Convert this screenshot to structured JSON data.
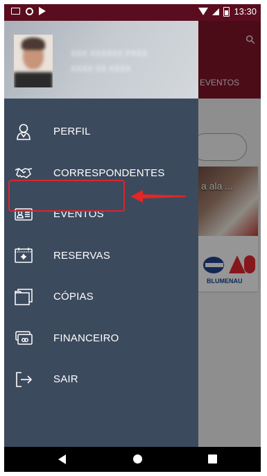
{
  "status_bar": {
    "time": "13:30",
    "icons": [
      "gmail-icon",
      "circle-notification-icon",
      "flag-notification-icon",
      "wifi-icon",
      "signal-icon",
      "battery-icon"
    ]
  },
  "app_background": {
    "tab_label": "EVENTOS",
    "card_text": "a ala ...",
    "logo_text": "BLUMENAU",
    "primary_color": "#7a1428"
  },
  "drawer": {
    "background_color": "#3c4a5e",
    "user_name": "XXX XXXXXX PXXX",
    "user_id": "XXXX XX XXXX",
    "menu_items": [
      {
        "label": "PERFIL",
        "icon": "user-profile-icon"
      },
      {
        "label": "CORRESPONDENTES",
        "icon": "handshake-icon"
      },
      {
        "label": "EVENTOS",
        "icon": "id-card-icon"
      },
      {
        "label": "RESERVAS",
        "icon": "calendar-icon"
      },
      {
        "label": "CÓPIAS",
        "icon": "folder-copies-icon"
      },
      {
        "label": "FINANCEIRO",
        "icon": "wallet-icon"
      },
      {
        "label": "SAIR",
        "icon": "logout-icon"
      }
    ],
    "highlight_color": "#d8262e"
  },
  "nav_bar": {
    "icons": [
      "back-icon",
      "home-icon",
      "recent-apps-icon"
    ]
  }
}
